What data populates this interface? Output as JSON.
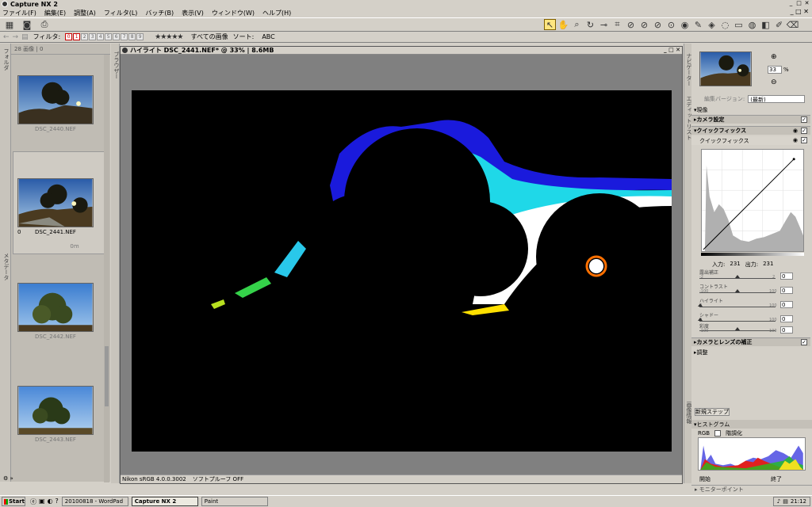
{
  "window": {
    "title": "Capture NX 2"
  },
  "menu": [
    "ファイル(F)",
    "編集(E)",
    "調整(A)",
    "フィルタ(L)",
    "バッチ(B)",
    "表示(V)",
    "ウィンドウ(W)",
    "ヘルプ(H)"
  ],
  "filter_bar": {
    "filter_label": "フィルタ:",
    "rating_boxes": [
      "0",
      "1",
      "2",
      "3",
      "4",
      "5",
      "6",
      "7",
      "8",
      "9"
    ],
    "stars": "★★★★★",
    "all_images": "すべての画像",
    "sort_label": "ソート:",
    "sort_value": "ABC"
  },
  "browser": {
    "top": "28 画像 | 0",
    "thumbs": [
      {
        "name": "DSC_2440.NEF"
      },
      {
        "name": "DSC_2441.NEF",
        "rating": "0",
        "meta": "0m"
      },
      {
        "name": "DSC_2442.NEF"
      },
      {
        "name": "DSC_2443.NEF"
      }
    ],
    "side_label": "フォルダ",
    "side_label2": "メタデータ"
  },
  "image_window": {
    "title": "ハイライト DSC_2441.NEF* @ 33% | 8.6MB",
    "status_profile": "Nikon sRGB 4.0.0.3002",
    "status_proof": "ソフトプルーフ OFF",
    "side_label": "ブラウザー"
  },
  "navigator": {
    "zoom_value": "33",
    "zoom_unit": "%",
    "side_label": "ナビゲーター"
  },
  "edit_list": {
    "side_label": "エディットリスト",
    "version_label": "編集バージョン:",
    "version_value": "(最新)",
    "current": "現像",
    "camera_settings": "カメラ設定",
    "quickfix": "クイックフィックス",
    "quickfix_sub": "クイックフィックス",
    "input_label": "入力:",
    "input_value": "231",
    "output_label": "出力:",
    "output_value": "231",
    "sliders": [
      {
        "label": "露出補正",
        "min": "-2",
        "max": "2",
        "value": "0"
      },
      {
        "label": "コントラスト",
        "min": "-100",
        "max": "100",
        "value": "0"
      },
      {
        "label": "ハイライト",
        "min": "0",
        "max": "100",
        "value": "0"
      },
      {
        "label": "シャドー",
        "min": "0",
        "max": "100",
        "value": "0"
      },
      {
        "label": "彩度",
        "min": "-100",
        "max": "100",
        "value": "0"
      }
    ],
    "camera_lens": "カメラとレンズの補正",
    "adjust": "調整",
    "new_step": "新規ステップ"
  },
  "histogram": {
    "side_label": "画像情報",
    "title": "ヒストグラム",
    "channel": "RGB",
    "grad_label": "階調化",
    "start_label": "開始",
    "end_label": "終了",
    "monitor": "モニターポイント"
  },
  "taskbar": {
    "start": "Start",
    "tasks": [
      "20100818 - WordPad",
      "Capture NX 2",
      "Paint"
    ],
    "clock": "21:12"
  }
}
